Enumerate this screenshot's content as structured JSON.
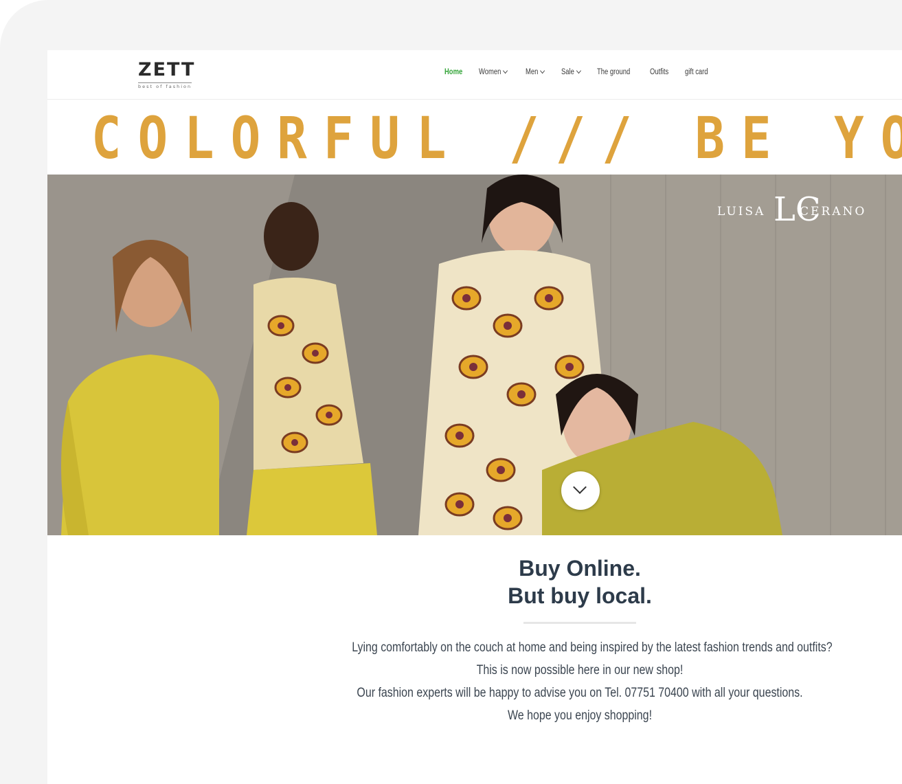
{
  "header": {
    "logo": {
      "word": "ZETT",
      "tagline": "best of fashion"
    },
    "nav": [
      {
        "label": "Home",
        "active": true,
        "dropdown": false
      },
      {
        "label": "Women",
        "active": false,
        "dropdown": true
      },
      {
        "label": "Men",
        "active": false,
        "dropdown": true
      },
      {
        "label": "Sale",
        "active": false,
        "dropdown": true
      },
      {
        "label": "The ground",
        "active": false,
        "dropdown": false
      },
      {
        "label": "Outfits",
        "active": false,
        "dropdown": false
      },
      {
        "label": "gift card",
        "active": false,
        "dropdown": false
      }
    ]
  },
  "banner": {
    "headline": "COLORFUL /// BE YOU ///"
  },
  "hero": {
    "brand_left": "LUISA",
    "brand_mono": "LC",
    "brand_right": "CERANO",
    "scroll_icon": "chevron-down-icon"
  },
  "intro": {
    "title_line1": "Buy Online.",
    "title_line2": "But buy local.",
    "paragraphs": [
      "Lying comfortably on the couch at home and being inspired by the latest fashion trends and outfits?",
      "This is now possible here in our new shop!",
      "Our fashion experts will be happy to advise you on Tel. 07751 70400 with all your questions.",
      "We hope you enjoy shopping!"
    ]
  },
  "colors": {
    "accent": "#dea33d",
    "nav_active": "#35a53a",
    "heading": "#2d3b4a",
    "device_frame": "#f4f4f4"
  }
}
